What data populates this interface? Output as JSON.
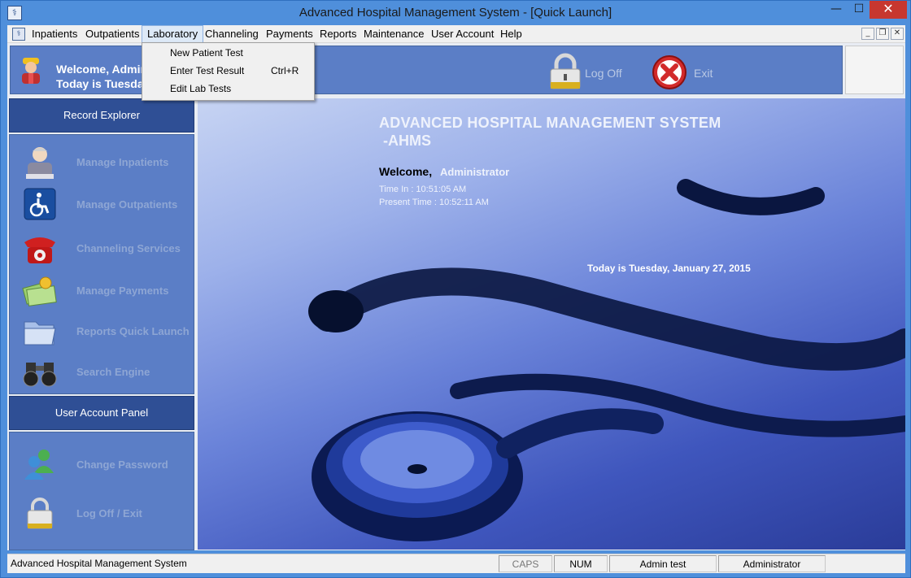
{
  "window": {
    "title": "Advanced Hospital Management System - [Quick Launch]",
    "min_symbol": "—",
    "max_symbol": "☐",
    "close_symbol": "✕"
  },
  "menu": {
    "items": [
      "Inpatients",
      "Outpatients",
      "Laboratory",
      "Channeling",
      "Payments",
      "Reports",
      "Maintenance",
      "User Account",
      "Help"
    ],
    "active": "Laboratory",
    "mdi_min": "_",
    "mdi_restore": "❐",
    "mdi_close": "✕"
  },
  "dropdown": {
    "items": [
      {
        "label": "New Patient Test",
        "shortcut": ""
      },
      {
        "label": "Enter Test Result",
        "shortcut": "Ctrl+R"
      },
      {
        "label": "Edit Lab Tests",
        "shortcut": ""
      }
    ]
  },
  "header": {
    "welcome": "Welcome, Admini",
    "today": "Today is Tuesday",
    "log_off": "Log Off",
    "exit": "Exit"
  },
  "sidebar": {
    "record_explorer": {
      "title": "Record Explorer",
      "items": [
        {
          "label": "Manage Inpatients",
          "icon": "nurse-icon"
        },
        {
          "label": "Manage Outpatients",
          "icon": "wheelchair-icon"
        },
        {
          "label": "Channeling Services",
          "icon": "telephone-icon"
        },
        {
          "label": "Manage Payments",
          "icon": "money-icon"
        },
        {
          "label": "Reports Quick Launch",
          "icon": "folder-icon"
        },
        {
          "label": "Search Engine",
          "icon": "binoculars-icon"
        }
      ]
    },
    "user_account_panel": {
      "title": "User Account Panel",
      "items": [
        {
          "label": "Change Password",
          "icon": "users-icon"
        },
        {
          "label": "Log Off / Exit",
          "icon": "lock-icon"
        }
      ]
    }
  },
  "main": {
    "title_line1": "ADVANCED HOSPITAL MANAGEMENT SYSTEM",
    "title_line2": "-AHMS",
    "welcome_label": "Welcome,",
    "welcome_user": "Administrator",
    "time_in": "Time In :   10:51:05 AM",
    "present_time": "Present Time :  10:52:11 AM",
    "today": "Today is Tuesday, January 27, 2015"
  },
  "status": {
    "main": "Advanced Hospital Management System",
    "caps": "CAPS",
    "num": "NUM",
    "user": "Admin test",
    "role": "Administrator"
  },
  "colors": {
    "accent": "#2f4f95",
    "panel": "#5b7ec6",
    "close_button": "#c7372f"
  }
}
